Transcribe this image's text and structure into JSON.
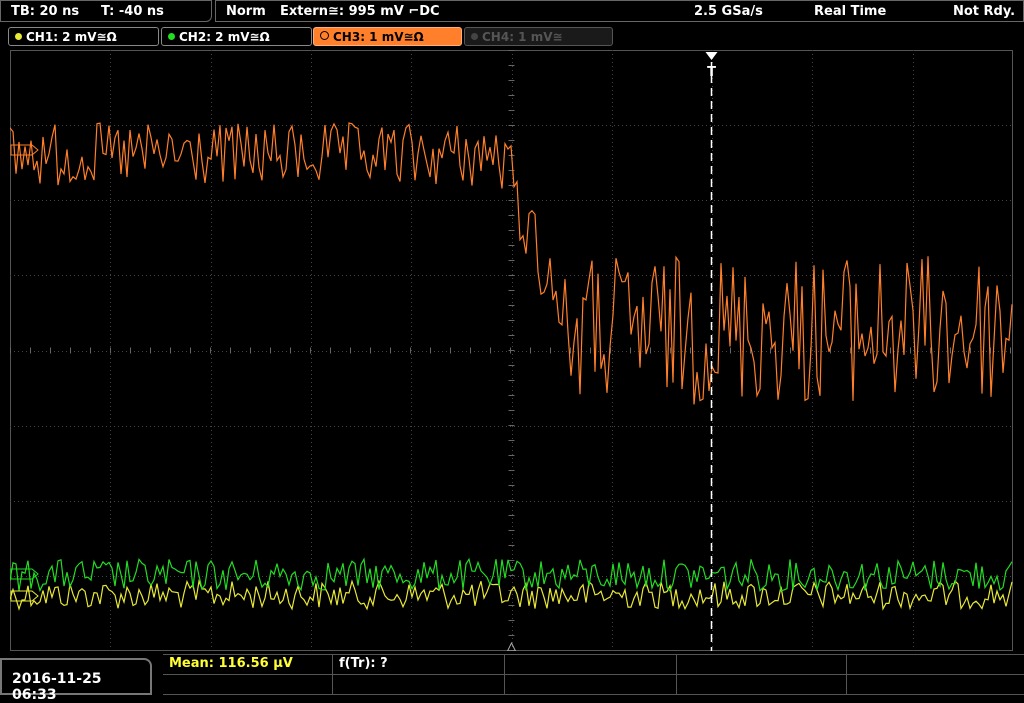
{
  "top": {
    "timebase": "TB: 20 ns",
    "trigger_time": "T: -40 ns",
    "mode": "Norm",
    "trigger_source": "Extern≅: 995 mV ⌐DC",
    "sample_rate": "2.5 GSa/s",
    "acq_mode": "Real Time",
    "status": "Not Rdy."
  },
  "channels": [
    {
      "label": "CH1: 2 mV≅Ω",
      "color": "#e8e836",
      "state": "on"
    },
    {
      "label": "CH2: 2 mV≅Ω",
      "color": "#22dd22",
      "state": "on"
    },
    {
      "label": "CH3: 1 mV≅Ω",
      "color": "#ff7f2a",
      "state": "selected"
    },
    {
      "label": "CH4: 1 mV≅",
      "color": "#666666",
      "state": "off"
    }
  ],
  "trigger_marker": "T",
  "bottom": {
    "datetime": "2016-11-25 06:33",
    "measurements": [
      {
        "label": "Mean: 116.56 µV",
        "color": "#ffff33"
      },
      {
        "label": "f(Tr): ?",
        "color": "#ffffff"
      }
    ]
  },
  "colors": {
    "ch3": "#ff7f2a",
    "ch1": "#e8e836",
    "ch2": "#22dd22",
    "grid": "#444444"
  }
}
